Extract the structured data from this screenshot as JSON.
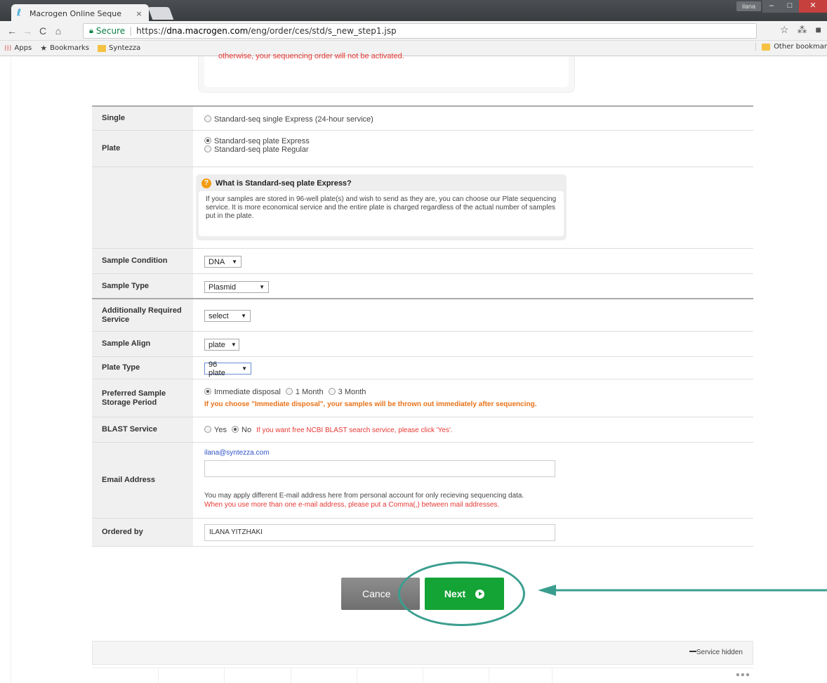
{
  "browser": {
    "tab_title": "Macrogen Online Seque",
    "tab_close": "×",
    "user_badge": "ilana",
    "min": "–",
    "max": "□",
    "close": "✕",
    "secure_label": "Secure",
    "url_prefix": "https://",
    "url_host": "dna.macrogen.com",
    "url_path": "/eng/order/ces/std/s_new_step1.jsp",
    "bookmarks": [
      {
        "label": "Apps"
      },
      {
        "label": "Bookmarks"
      },
      {
        "label": "Syntezza"
      }
    ],
    "other_bookmarks": "Other bookmar"
  },
  "top_tip_red": "otherwise, your sequencing order will not be activated.",
  "form": {
    "single": {
      "label": "Single",
      "option": "Standard-seq single Express (24-hour service)"
    },
    "plate": {
      "label": "Plate",
      "options": [
        "Standard-seq plate Express",
        "Standard-seq plate Regular"
      ],
      "selected": "Standard-seq plate Express"
    },
    "info": {
      "title": "What is Standard-seq plate Express?",
      "body": "If your samples are stored in 96-well plate(s) and wish to send as they are, you can choose our Plate sequencing service. It is more economical service and the entire plate is charged regardless of the actual number of samples put in the plate."
    },
    "sample_condition": {
      "label": "Sample Condition",
      "value": "DNA"
    },
    "sample_type": {
      "label": "Sample Type",
      "value": "Plasmid"
    },
    "additional_service": {
      "label_line1": "Additionally Required",
      "label_line2": "Service",
      "value": "select"
    },
    "sample_align": {
      "label": "Sample Align",
      "value": "plate"
    },
    "plate_type": {
      "label": "Plate Type",
      "value": "96 plate"
    },
    "storage": {
      "label_line1": "Preferred Sample",
      "label_line2": "Storage Period",
      "options": [
        "Immediate disposal",
        "1 Month",
        "3 Month"
      ],
      "selected": "Immediate disposal",
      "warning": "If you choose \"Immediate disposal\", your samples will be thrown out immediately after sequencing."
    },
    "blast": {
      "label": "BLAST Service",
      "yes": "Yes",
      "no": "No",
      "selected": "No",
      "note": "If you want free NCBI BLAST search service, please click 'Yes'."
    },
    "email": {
      "label": "Email Address",
      "current": "ilana@syntezza.com",
      "input_value": "",
      "note": "You may apply different E-mail address here from personal account for only recieving sequencing data.",
      "note_red": "When you use more than one e-mail address, please put a Comma(,) between mail addresses."
    },
    "ordered_by": {
      "label": "Ordered by",
      "value": "ILANA YITZHAKI"
    }
  },
  "buttons": {
    "cancel": "Cance",
    "next": "Next"
  },
  "footer": {
    "service_hidden": "Service hidden",
    "dots": "●●●"
  },
  "colors": {
    "next_green": "#14a335",
    "annotation_teal": "#3a9e8e",
    "warning_orange": "#e8731a",
    "note_red": "#e53935"
  }
}
